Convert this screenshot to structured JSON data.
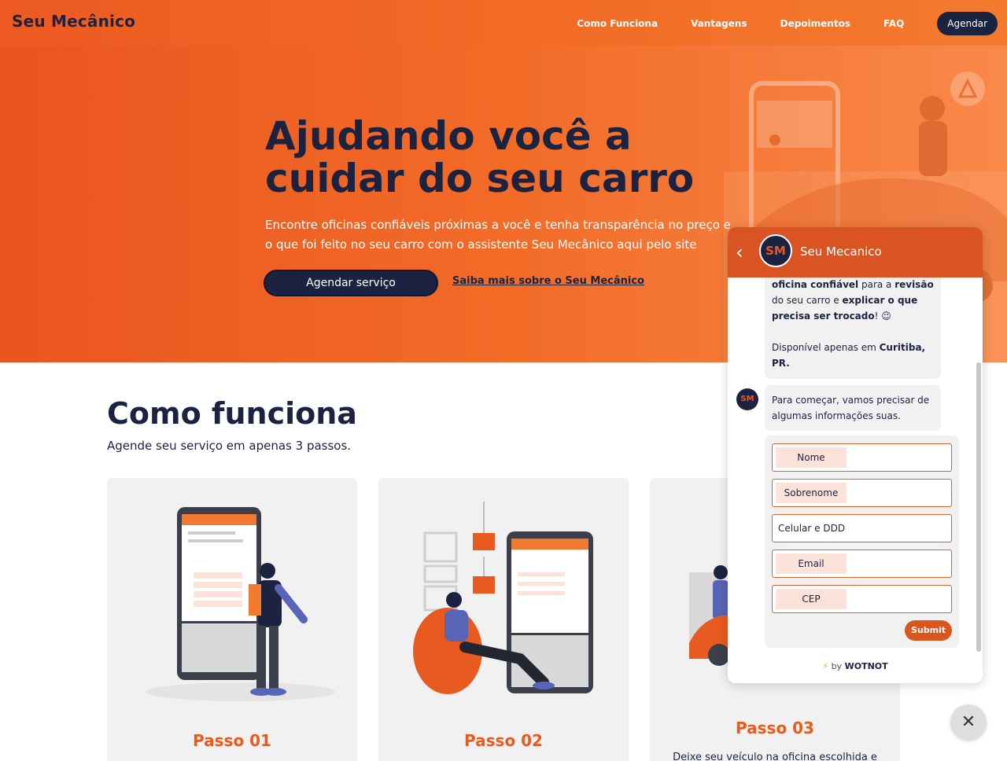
{
  "nav": {
    "brand": "Seu Mecânico",
    "links": [
      "Como Funciona",
      "Vantagens",
      "Depoimentos",
      "FAQ"
    ],
    "cta": "Agendar"
  },
  "hero": {
    "title_line1": "Ajudando você a",
    "title_line2": "cuidar do seu carro",
    "subtitle": "Encontre oficinas confiáveis próximas a você e tenha transparência no preço e o que foi feito no seu carro com o assistente Seu Mecânico aqui pelo site",
    "primary_button": "Agendar serviço",
    "secondary_link": "Saiba mais sobre o Seu Mecânico"
  },
  "how": {
    "title": "Como funciona",
    "subtitle": "Agende seu serviço em apenas 3 passos.",
    "steps": [
      {
        "label": "Passo 01",
        "description": ""
      },
      {
        "label": "Passo 02",
        "description": ""
      },
      {
        "label": "Passo 03",
        "description": "Deixe seu veículo na oficina escolhida e"
      }
    ]
  },
  "chat": {
    "name": "Seu Mecanico",
    "avatar_text": "SM",
    "message1_parts": {
      "a": "oficina confiável",
      "b": " para a ",
      "c": "revisão",
      "d": " do seu carro e ",
      "e": "explicar o que precisa ser trocado",
      "f": "! 😉",
      "g": "Disponível apenas em ",
      "h": "Curitiba, PR."
    },
    "message2": "Para começar, vamos precisar de algumas informações suas.",
    "form_fields": [
      "Nome",
      "Sobrenome",
      "Celular e DDD",
      "Email",
      "CEP"
    ],
    "submit": "Submit",
    "footer_bolt": "⚡",
    "footer_by": "by ",
    "footer_brand": "WOTNOT",
    "close": "✕"
  },
  "colors": {
    "orange": "#ec5a22",
    "navy": "#1b2340",
    "chat_header": "#da5322"
  }
}
